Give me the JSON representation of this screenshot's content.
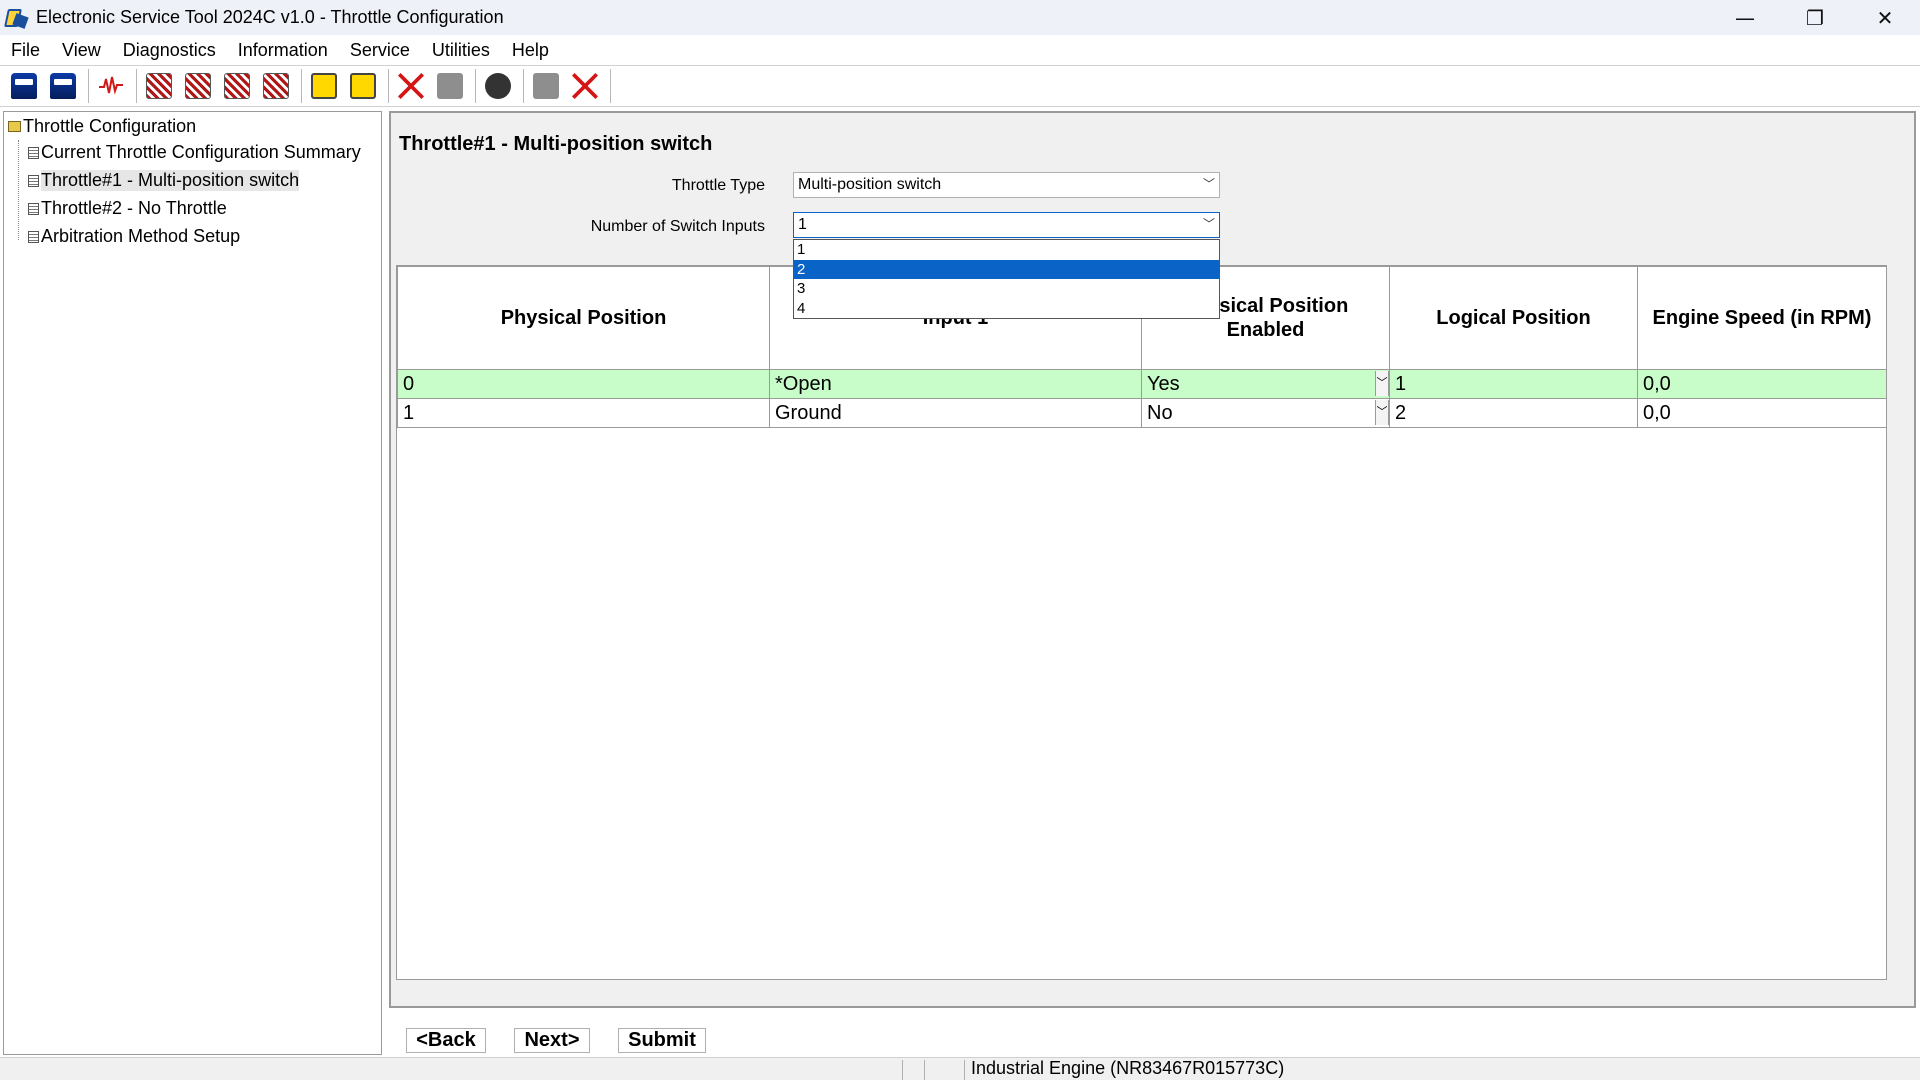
{
  "window": {
    "title": "Electronic Service Tool 2024C v1.0 - Throttle Configuration",
    "minimize": "—",
    "restore": "❐",
    "close": "✕"
  },
  "menu": [
    "File",
    "View",
    "Diagnostics",
    "Information",
    "Service",
    "Utilities",
    "Help"
  ],
  "tree": {
    "root": "Throttle Configuration",
    "items": [
      "Current Throttle Configuration Summary",
      "Throttle#1 - Multi-position switch",
      "Throttle#2 - No Throttle",
      "Arbitration Method Setup"
    ],
    "selected_index": 1
  },
  "main": {
    "title": "Throttle#1 - Multi-position switch",
    "throttle_type_label": "Throttle Type",
    "throttle_type_value": "Multi-position switch",
    "switch_inputs_label": "Number of Switch Inputs",
    "switch_inputs_value": "1",
    "dropdown_options": [
      "1",
      "2",
      "3",
      "4"
    ],
    "dropdown_selected": "2",
    "columns": [
      "Physical Position",
      "Input 1",
      "Physical Position Enabled",
      "Logical Position",
      "Engine Speed (in RPM)"
    ],
    "rows": [
      {
        "physical": "0",
        "input": "*Open",
        "enabled": "Yes",
        "logical": "1",
        "speed": "0,0"
      },
      {
        "physical": "1",
        "input": "Ground",
        "enabled": "No",
        "logical": "2",
        "speed": "0,0"
      }
    ]
  },
  "buttons": {
    "back": "<Back",
    "next": "Next>",
    "submit": "Submit"
  },
  "status": {
    "engine": "Industrial Engine (NR83467R015773C)"
  },
  "icons": {
    "dropdown_arrow": "﹀",
    "wave": "wave-icon"
  },
  "colors": {
    "selected_row": "#c8fcc8",
    "dropdown_highlight": "#0a64c8"
  }
}
